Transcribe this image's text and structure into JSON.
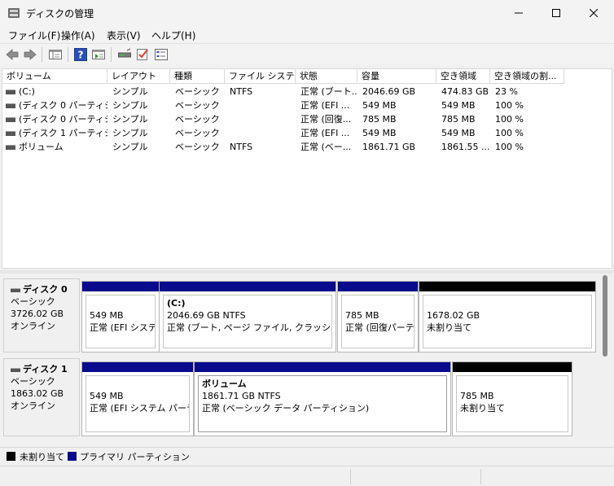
{
  "window": {
    "title": "ディスクの管理",
    "icon": "disk-management-icon"
  },
  "menu": [
    {
      "label": "ファイル(F)"
    },
    {
      "label": "操作(A)"
    },
    {
      "label": "表示(V)"
    },
    {
      "label": "ヘルプ(H)"
    }
  ],
  "toolbar": {
    "icons": [
      "back-arrow-icon",
      "forward-arrow-icon",
      "console-tree-icon",
      "help-icon",
      "action-pane-icon",
      "connect-icon",
      "check-icon",
      "properties-icon"
    ]
  },
  "volume_table": {
    "columns": [
      "ボリューム",
      "レイアウト",
      "種類",
      "ファイル システム",
      "状態",
      "容量",
      "空き領域",
      "空き領域の割..."
    ],
    "rows": [
      [
        "(C:)",
        "シンプル",
        "ベーシック",
        "NTFS",
        "正常 (ブート...",
        "2046.69 GB",
        "474.83 GB",
        "23 %"
      ],
      [
        "(ディスク 0 パーティシ...",
        "シンプル",
        "ベーシック",
        "",
        "正常 (EFI ...",
        "549 MB",
        "549 MB",
        "100 %"
      ],
      [
        "(ディスク 0 パーティシ...",
        "シンプル",
        "ベーシック",
        "",
        "正常 (回復...",
        "785 MB",
        "785 MB",
        "100 %"
      ],
      [
        "(ディスク 1 パーティシ...",
        "シンプル",
        "ベーシック",
        "",
        "正常 (EFI ...",
        "549 MB",
        "549 MB",
        "100 %"
      ],
      [
        "ボリューム",
        "シンプル",
        "ベーシック",
        "NTFS",
        "正常 (ベー...",
        "1861.71 GB",
        "1861.55 ...",
        "100 %"
      ]
    ]
  },
  "disks": [
    {
      "name": "ディスク 0",
      "type": "ベーシック",
      "size": "3726.02 GB",
      "status": "オンライン",
      "partitions": [
        {
          "name": "",
          "size": "549 MB",
          "status": "正常 (EFI システ."
        },
        {
          "name": "(C:)",
          "size": "2046.69 GB NTFS",
          "status": "正常 (ブート, ページ ファイル, クラッシュ ダンプ"
        },
        {
          "name": "",
          "size": "785 MB",
          "status": "正常 (回復パーテ"
        },
        {
          "name": "",
          "size": "1678.02 GB",
          "status": "未割り当て"
        }
      ]
    },
    {
      "name": "ディスク 1",
      "type": "ベーシック",
      "size": "1863.02 GB",
      "status": "オンライン",
      "partitions": [
        {
          "name": "",
          "size": "549 MB",
          "status": "正常 (EFI システム パーティ"
        },
        {
          "name": "ボリューム",
          "size": "1861.71 GB NTFS",
          "status": "正常 (ベーシック データ パーティション)"
        },
        {
          "name": "",
          "size": "785 MB",
          "status": "未割り当て"
        }
      ]
    }
  ],
  "legend": {
    "unallocated": "未割り当て",
    "primary": "プライマリ パーティション"
  },
  "colors": {
    "primary_partition": "#0a0a8c",
    "unallocated": "#000000"
  }
}
